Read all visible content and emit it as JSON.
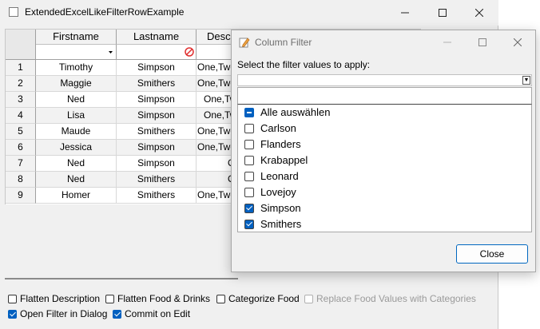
{
  "window": {
    "title": "ExtendedExcelLikeFilterRowExample"
  },
  "grid": {
    "columns": [
      "Firstname",
      "Lastname",
      "Desc"
    ],
    "rows": [
      {
        "num": "1",
        "first": "Timothy",
        "last": "Simpson",
        "desc": "One,Two"
      },
      {
        "num": "2",
        "first": "Maggie",
        "last": "Smithers",
        "desc": "One,Two"
      },
      {
        "num": "3",
        "first": "Ned",
        "last": "Simpson",
        "desc": "One,Tw"
      },
      {
        "num": "4",
        "first": "Lisa",
        "last": "Simpson",
        "desc": "One,Tw"
      },
      {
        "num": "5",
        "first": "Maude",
        "last": "Smithers",
        "desc": "One,Two"
      },
      {
        "num": "6",
        "first": "Jessica",
        "last": "Simpson",
        "desc": "One,Two"
      },
      {
        "num": "7",
        "first": "Ned",
        "last": "Simpson",
        "desc": "O"
      },
      {
        "num": "8",
        "first": "Ned",
        "last": "Smithers",
        "desc": "O"
      },
      {
        "num": "9",
        "first": "Homer",
        "last": "Smithers",
        "desc": "One,Two"
      }
    ]
  },
  "options": {
    "flatten_description": "Flatten Description",
    "flatten_food": "Flatten Food & Drinks",
    "categorize_food": "Categorize Food",
    "replace_food": "Replace Food Values with Categories",
    "open_filter_dialog": "Open Filter in Dialog",
    "commit_on_edit": "Commit on Edit"
  },
  "dialog": {
    "title": "Column Filter",
    "prompt": "Select the filter values to apply:",
    "items": [
      {
        "label": "Alle auswählen",
        "state": "indeterminate"
      },
      {
        "label": "Carlson",
        "state": "unchecked"
      },
      {
        "label": "Flanders",
        "state": "unchecked"
      },
      {
        "label": "Krabappel",
        "state": "unchecked"
      },
      {
        "label": "Leonard",
        "state": "unchecked"
      },
      {
        "label": "Lovejoy",
        "state": "unchecked"
      },
      {
        "label": "Simpson",
        "state": "checked"
      },
      {
        "label": "Smithers",
        "state": "checked"
      }
    ],
    "close_label": "Close"
  },
  "colors": {
    "accent": "#0060c0",
    "filter_icon": "#e03030"
  },
  "icons": [
    "app-window-icon",
    "minimize-icon",
    "maximize-icon",
    "close-icon",
    "dropdown-arrow-icon",
    "filter-active-icon",
    "edit-pencil-icon"
  ]
}
